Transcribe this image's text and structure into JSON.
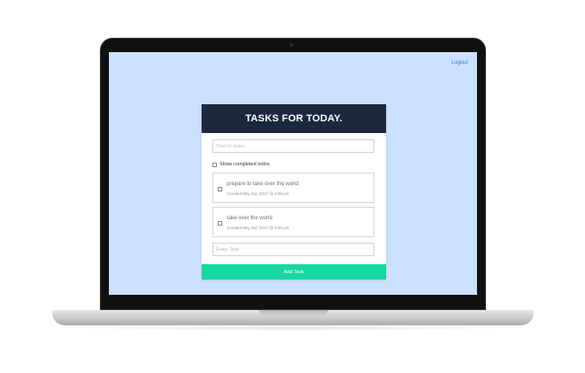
{
  "header": {
    "logout_label": "Logout"
  },
  "card": {
    "title": "TASKS FOR TODAY.",
    "search": {
      "placeholder": "Search tasks",
      "value": ""
    },
    "show_completed_label": "Show completed todos",
    "todos": [
      {
        "title": "prepare to take over the world",
        "created": "Created May 3rd, 2017 @ 2:00 pm",
        "checked": false
      },
      {
        "title": "take over the world",
        "created": "Created May 3rd, 2017 @ 2:00 pm",
        "checked": false
      }
    ],
    "new_task": {
      "placeholder": "Enter Task",
      "value": ""
    },
    "add_button_label": "Add Task"
  },
  "colors": {
    "screen_bg": "#cce1fe",
    "header_bg": "#1b2840",
    "accent_green": "#17d6a0",
    "link_blue": "#2e7ecf"
  }
}
